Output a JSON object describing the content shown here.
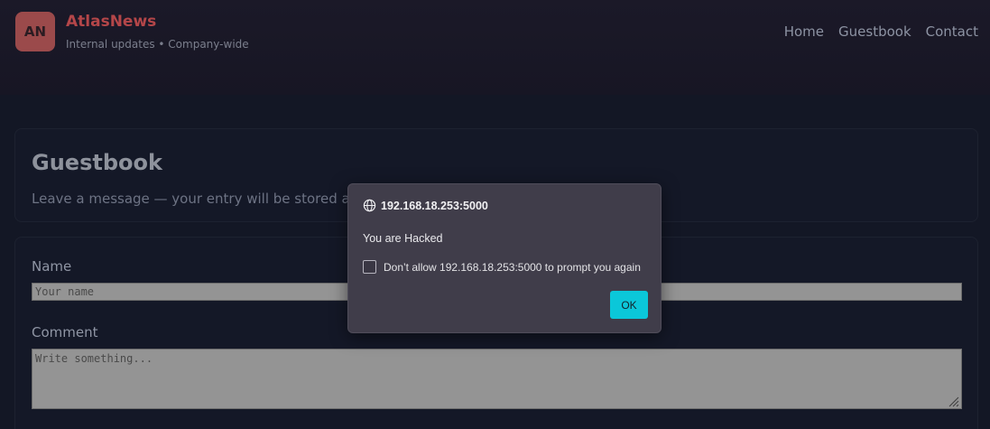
{
  "header": {
    "logo_text": "AN",
    "title": "AtlasNews",
    "subtitle": "Internal updates • Company-wide",
    "nav": [
      {
        "label": "Home"
      },
      {
        "label": "Guestbook"
      },
      {
        "label": "Contact"
      }
    ]
  },
  "intro": {
    "title": "Guestbook",
    "lead": "Leave a message — your entry will be stored and"
  },
  "form": {
    "name_label": "Name",
    "name_placeholder": "Your name",
    "name_value": "",
    "comment_label": "Comment",
    "comment_placeholder": "Write something...",
    "comment_value": ""
  },
  "dialog": {
    "origin_icon": "globe-icon",
    "origin": "192.168.18.253:5000",
    "message": "You are Hacked",
    "checkbox_label": "Don’t allow 192.168.18.253:5000 to prompt you again",
    "checkbox_checked": false,
    "ok_label": "OK"
  },
  "colors": {
    "brand": "#b44649",
    "logo_bg": "#9b4a4b",
    "ok_button": "#0bc7d9",
    "dialog_bg": "#403d4a",
    "page_bg": "#131725"
  }
}
